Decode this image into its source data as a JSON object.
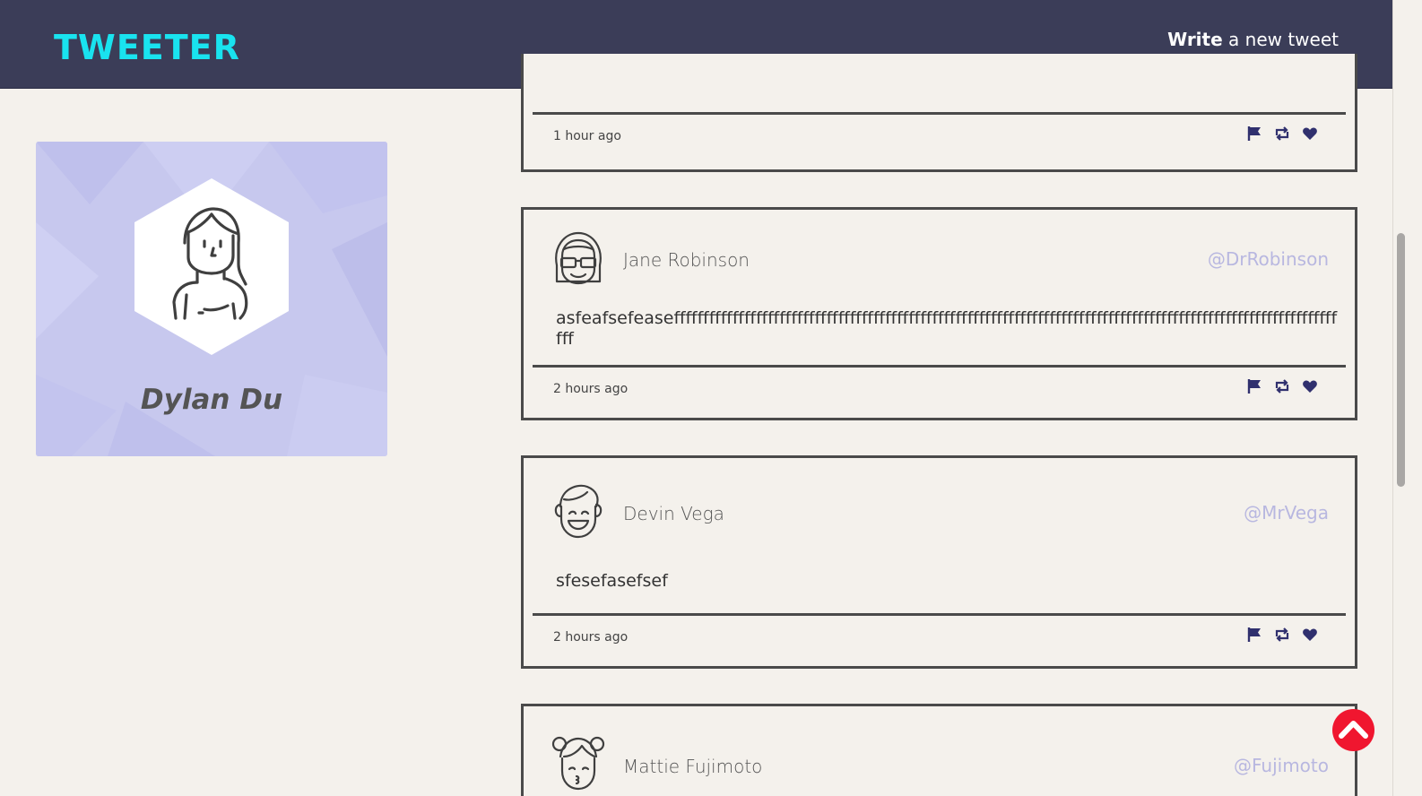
{
  "nav": {
    "brand": "TWEETER",
    "compose_bold": "Write",
    "compose_rest": " a new tweet",
    "chevron_icon": "chevron-down-icon",
    "chevron_color": "#E53935"
  },
  "profile": {
    "name": "Dylan Du",
    "avatar_icon": "female-avatar-icon"
  },
  "tweets": [
    {
      "time": "1 hour ago"
    },
    {
      "name": "Jane Robinson",
      "handle": "@DrRobinson",
      "avatar_icon": "avatar-glasses-icon",
      "body": "asfeafsefeaseffffffffffffffffffffffffffffffffffffffffffffffffffffffffffffffffffffffffffffffffffffffffffffffffffffffffffffffffffff",
      "time": "2 hours ago"
    },
    {
      "name": "Devin Vega",
      "handle": "@MrVega",
      "avatar_icon": "avatar-smiling-man-icon",
      "body": "sfesefasefsef",
      "time": "2 hours ago"
    },
    {
      "name": "Mattie Fujimoto",
      "handle": "@Fujimoto",
      "avatar_icon": "avatar-kissing-girl-icon"
    }
  ],
  "actions": {
    "flag_icon": "flag-icon",
    "retweet_icon": "retweet-icon",
    "like_icon": "heart-icon",
    "icon_color": "#30306E"
  },
  "scroll_top": {
    "icon": "chevron-up-icon",
    "color": "#F0162F"
  },
  "colors": {
    "nav_bg": "#3B3D58",
    "brand": "#19E3EF",
    "page_bg": "#F4F1EC",
    "profile_bg": "#C7C8EE",
    "handle": "#B8B7E0"
  }
}
